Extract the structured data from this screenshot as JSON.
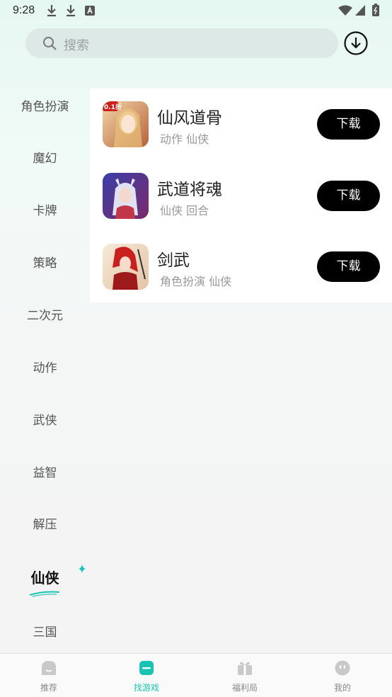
{
  "status": {
    "time": "9:28"
  },
  "search": {
    "placeholder": "搜索"
  },
  "categories": {
    "items": [
      "角色扮演",
      "魔幻",
      "卡牌",
      "策略",
      "二次元",
      "动作",
      "武侠",
      "益智",
      "解压",
      "仙侠",
      "三国"
    ],
    "selected": "仙侠"
  },
  "games": [
    {
      "name": "仙风道骨",
      "tags": "动作 仙侠",
      "button": "下载",
      "badge": "0.1折"
    },
    {
      "name": "武道将魂",
      "tags": "仙侠 回合",
      "button": "下载"
    },
    {
      "name": "剑武",
      "tags": "角色扮演 仙侠",
      "button": "下载"
    }
  ],
  "nav": {
    "items": [
      {
        "label": "推荐",
        "icon": "recommend-icon"
      },
      {
        "label": "找游戏",
        "icon": "find-game-icon"
      },
      {
        "label": "福利局",
        "icon": "gift-icon"
      },
      {
        "label": "我的",
        "icon": "profile-icon"
      }
    ],
    "active": "找游戏"
  },
  "colors": {
    "accent": "#18c3b3",
    "button": "#000000"
  }
}
